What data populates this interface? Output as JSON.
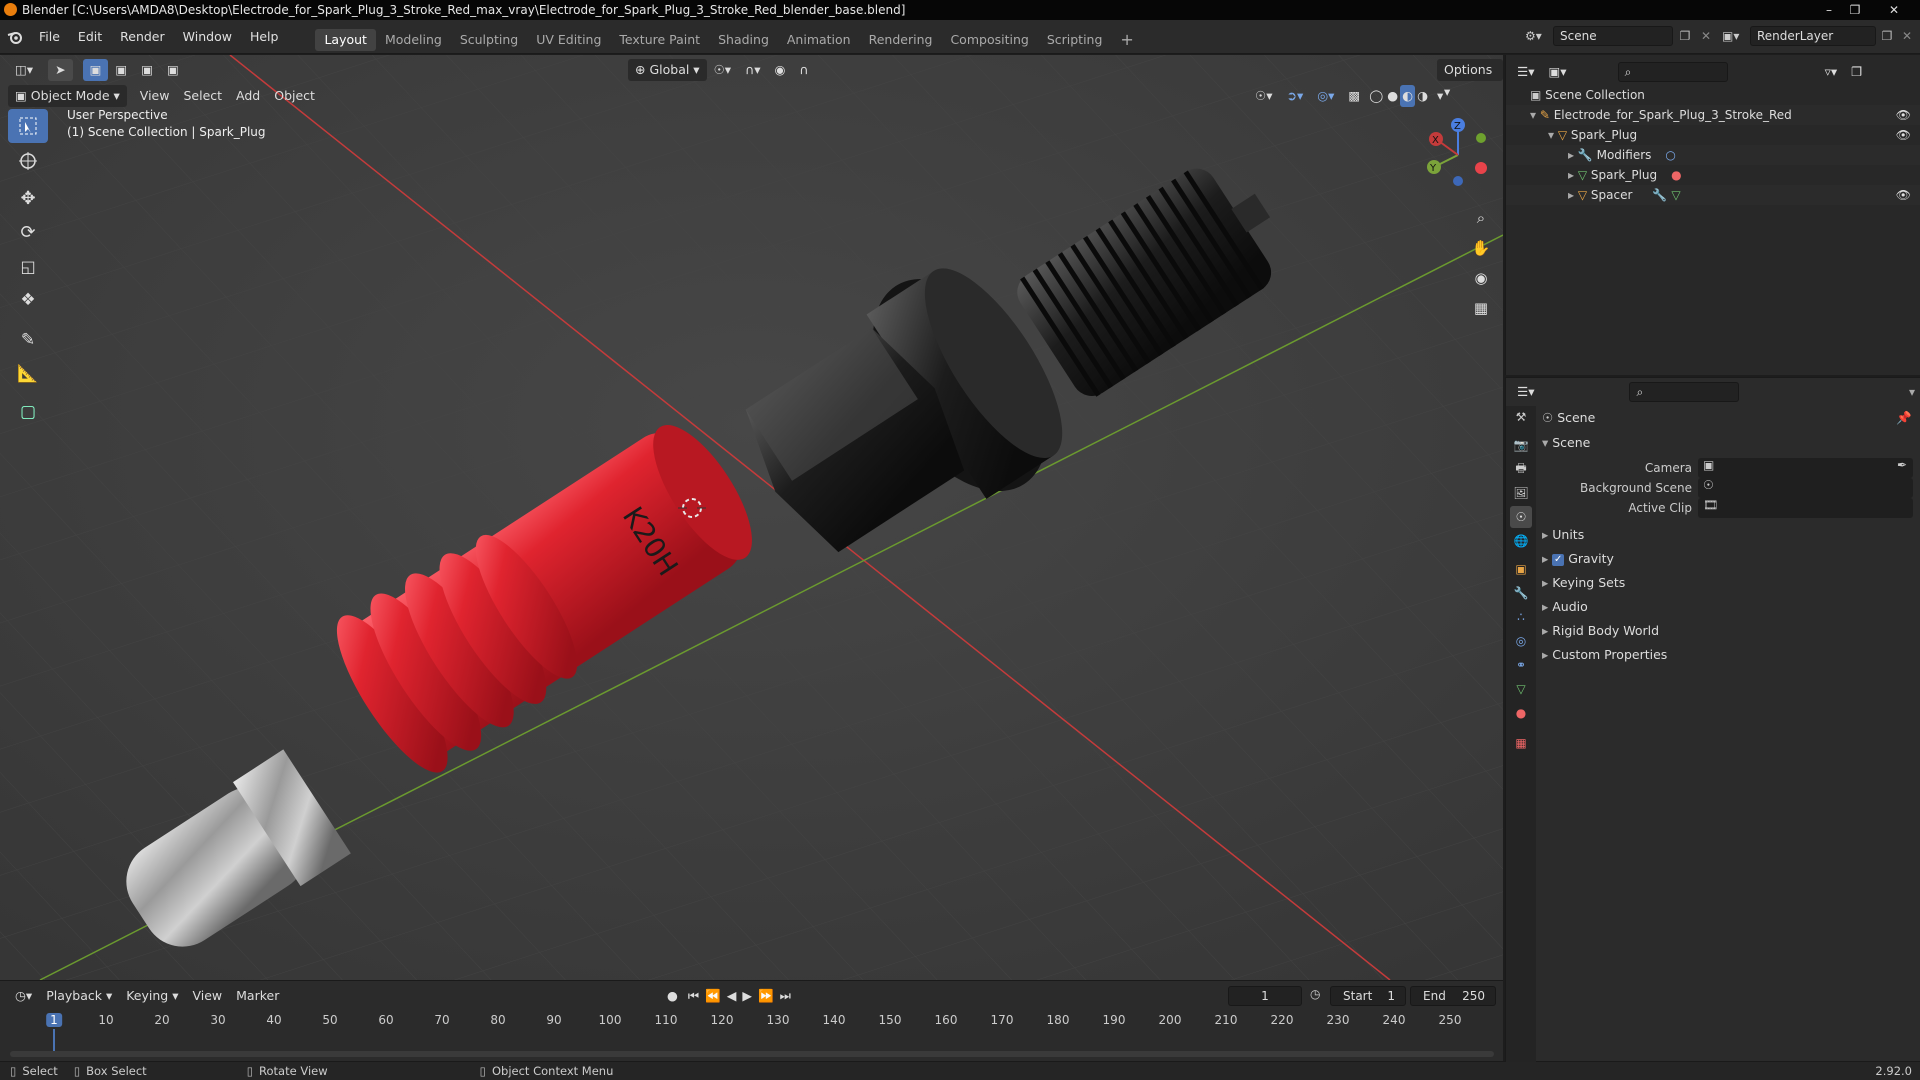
{
  "titlebar": {
    "title": "Blender [C:\\Users\\AMDA8\\Desktop\\Electrode_for_Spark_Plug_3_Stroke_Red_max_vray\\Electrode_for_Spark_Plug_3_Stroke_Red_blender_base.blend]"
  },
  "menu": [
    "File",
    "Edit",
    "Render",
    "Window",
    "Help"
  ],
  "workspaces": [
    "Layout",
    "Modeling",
    "Sculpting",
    "UV Editing",
    "Texture Paint",
    "Shading",
    "Animation",
    "Rendering",
    "Compositing",
    "Scripting"
  ],
  "scene_field": "Scene",
  "renderlayer_field": "RenderLayer",
  "viewport": {
    "transform_orientation": "Global",
    "options_label": "Options",
    "mode": "Object Mode",
    "menus": [
      "View",
      "Select",
      "Add",
      "Object"
    ],
    "perspective_label": "User Perspective",
    "collection_label": "(1) Scene Collection | Spark_Plug",
    "model_text": "K20H",
    "gizmo": {
      "x": "X",
      "y": "Y",
      "z": "Z"
    }
  },
  "outliner": {
    "root": "Scene Collection",
    "items": [
      {
        "label": "Electrode_for_Spark_Plug_3_Stroke_Red"
      },
      {
        "label": "Spark_Plug"
      },
      {
        "label": "Modifiers"
      },
      {
        "label": "Spark_Plug"
      },
      {
        "label": "Spacer"
      }
    ]
  },
  "properties": {
    "header": "Scene",
    "panel": "Scene",
    "fields": [
      {
        "label": "Camera"
      },
      {
        "label": "Background Scene"
      },
      {
        "label": "Active Clip"
      }
    ],
    "subpanels": [
      "Units",
      "Gravity",
      "Keying Sets",
      "Audio",
      "Rigid Body World",
      "Custom Properties"
    ]
  },
  "timeline": {
    "menus": [
      "Playback",
      "Keying",
      "View",
      "Marker"
    ],
    "current_frame": "1",
    "start_label": "Start",
    "start_value": "1",
    "end_label": "End",
    "end_value": "250",
    "ticks": [
      "1",
      "10",
      "20",
      "30",
      "40",
      "50",
      "60",
      "70",
      "80",
      "90",
      "100",
      "110",
      "120",
      "130",
      "140",
      "150",
      "160",
      "170",
      "180",
      "190",
      "200",
      "210",
      "220",
      "230",
      "240",
      "250"
    ]
  },
  "statusbar": {
    "select": "Select",
    "box_select": "Box Select",
    "rotate": "Rotate View",
    "context": "Object Context Menu",
    "version": "2.92.0"
  },
  "colors": {
    "accent": "#4a73b3",
    "active_frame": "#4a73b3",
    "axis_x": "#c43b3b",
    "axis_y": "#6b9a2f",
    "plug_red": "#e0242f"
  }
}
